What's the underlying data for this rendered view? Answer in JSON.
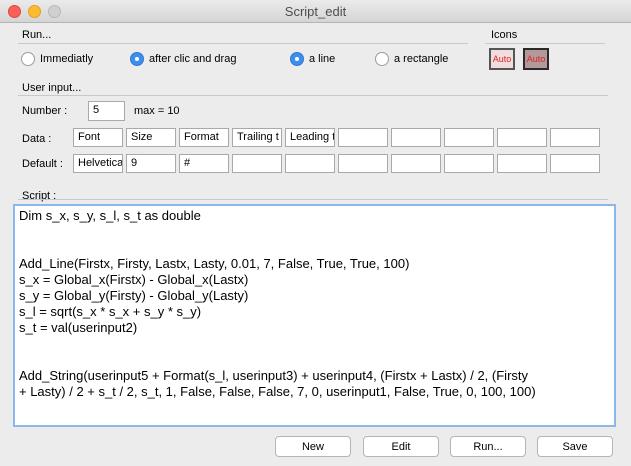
{
  "window": {
    "title": "Script_edit"
  },
  "run": {
    "section_label": "Run...",
    "options": [
      {
        "label": "Immediatly",
        "selected": false
      },
      {
        "label": "after clic and drag",
        "selected": true
      },
      {
        "label": "a line",
        "selected": true
      },
      {
        "label": "a rectangle",
        "selected": false
      }
    ]
  },
  "icons": {
    "section_label": "Icons",
    "items": [
      {
        "label": "Auto"
      },
      {
        "label": "Auto"
      }
    ]
  },
  "user_input": {
    "section_label": "User input...",
    "number_label": "Number :",
    "number_value": "5",
    "max_label": "max = 10",
    "data_label": "Data :",
    "default_label": "Default :",
    "data_fields": [
      "Font",
      "Size",
      "Format",
      "Trailing t",
      "Leading t",
      "",
      "",
      "",
      "",
      ""
    ],
    "default_fields": [
      "Helvetica",
      "9",
      "#",
      "",
      "",
      "",
      "",
      "",
      "",
      ""
    ]
  },
  "script": {
    "section_label": "Script :",
    "lines": [
      "Dim s_x, s_y, s_l, s_t as double",
      "",
      "",
      "Add_Line(Firstx, Firsty, Lastx, Lasty, 0.01, 7, False, True, True, 100)",
      "s_x = Global_x(Firstx) - Global_x(Lastx)",
      "s_y = Global_y(Firsty) - Global_y(Lasty)",
      "s_l = sqrt(s_x * s_x + s_y * s_y)",
      "s_t = val(userinput2)",
      "",
      "",
      "Add_String(userinput5 + Format(s_l, userinput3) + userinput4, (Firstx + Lastx) / 2, (Firsty",
      "+ Lasty) / 2 + s_t / 2, s_t, 1, False, False, False, 7, 0, userinput1, False, True, 0, 100, 100)"
    ]
  },
  "buttons": {
    "new": "New",
    "edit": "Edit",
    "run": "Run...",
    "save": "Save"
  }
}
